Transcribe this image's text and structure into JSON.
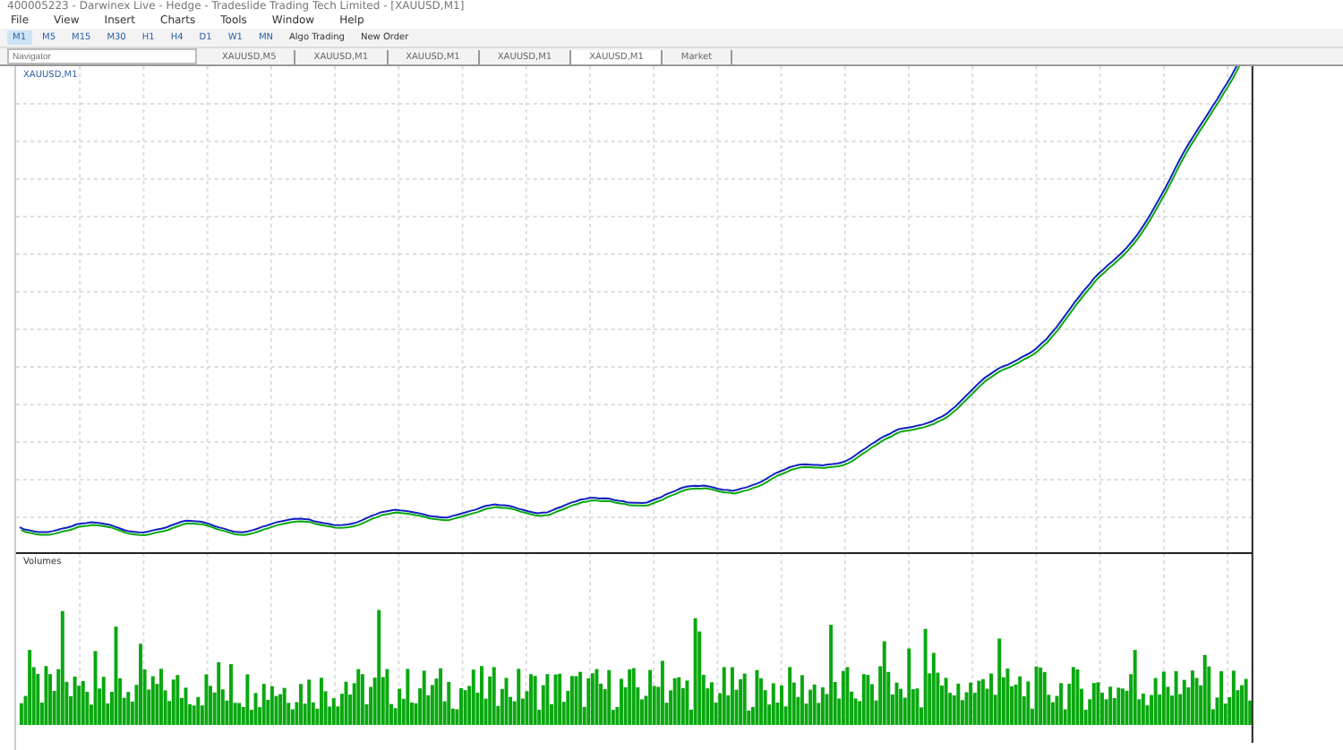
{
  "window": {
    "title": "400005223 - Darwinex Live - Hedge - Tradeslide Trading Tech Limited - [XAUUSD,M1]"
  },
  "menu": [
    "File",
    "View",
    "Insert",
    "Charts",
    "Tools",
    "Window",
    "Help"
  ],
  "timeframes": [
    {
      "label": "M1",
      "selected": true
    },
    {
      "label": "M5",
      "selected": false
    },
    {
      "label": "M15",
      "selected": false
    },
    {
      "label": "M30",
      "selected": false
    },
    {
      "label": "H1",
      "selected": false
    },
    {
      "label": "H4",
      "selected": false
    },
    {
      "label": "D1",
      "selected": false
    },
    {
      "label": "W1",
      "selected": false
    },
    {
      "label": "MN",
      "selected": false
    }
  ],
  "toolbar_buttons": [
    "Algo Trading",
    "New Order"
  ],
  "navigator": {
    "placeholder": "Navigator"
  },
  "chart_tabs": [
    {
      "label": "XAUUSD,M5",
      "selected": false
    },
    {
      "label": "XAUUSD,M1",
      "selected": false
    },
    {
      "label": "XAUUSD,M1",
      "selected": false
    },
    {
      "label": "XAUUSD,M1",
      "selected": false
    },
    {
      "label": "XAUUSD,M1",
      "selected": true
    },
    {
      "label": "Market",
      "selected": false
    }
  ],
  "chart": {
    "symbol_label": "XAUUSD,M1",
    "volume_label": "Volumes"
  }
}
